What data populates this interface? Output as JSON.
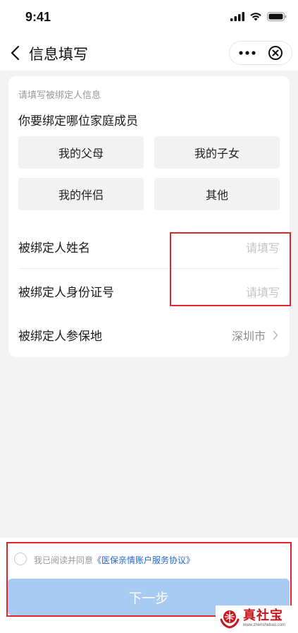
{
  "status_bar": {
    "time": "9:41"
  },
  "nav": {
    "title": "信息填写"
  },
  "form": {
    "hint": "请填写被绑定人信息",
    "question": "你要绑定哪位家庭成员",
    "options": [
      "我的父母",
      "我的子女",
      "我的伴侣",
      "其他"
    ],
    "fields": [
      {
        "label": "被绑定人姓名",
        "placeholder": "请填写"
      },
      {
        "label": "被绑定人身份证号",
        "placeholder": "请填写"
      },
      {
        "label": "被绑定人参保地",
        "value": "深圳市"
      }
    ]
  },
  "agreement": {
    "text": "我已阅读并同意",
    "link": "《医保亲情账户服务协议》"
  },
  "next_button": {
    "label": "下一步"
  },
  "watermark": {
    "name": "真社宝",
    "url": "www.zhenshebao.com"
  },
  "colors": {
    "primary_button": "#a8cbf3",
    "link": "#2a67c9",
    "highlight_box": "#e0262b",
    "watermark": "#c8161d"
  }
}
